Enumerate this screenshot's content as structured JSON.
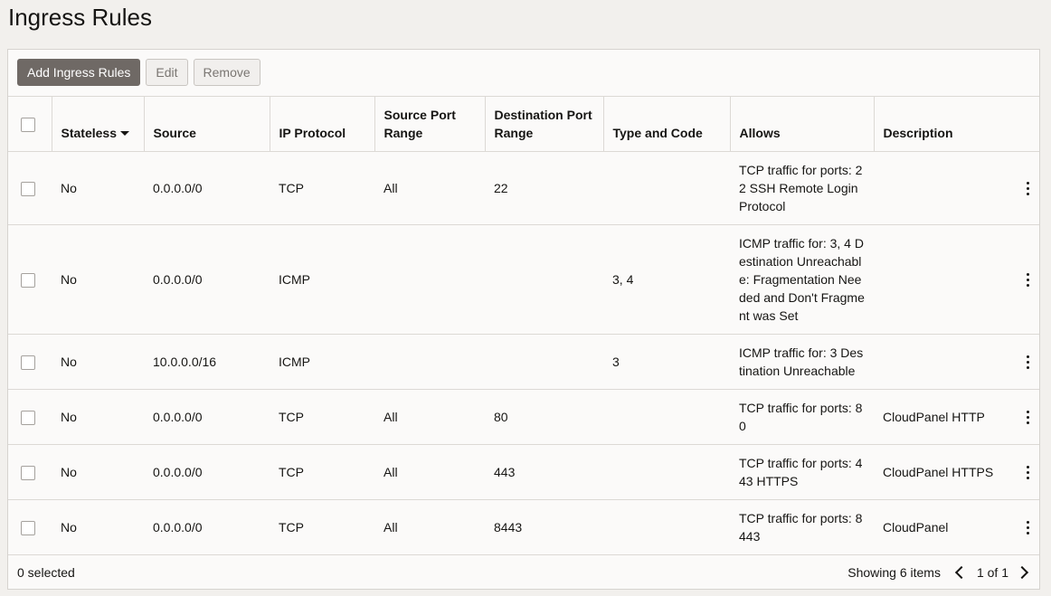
{
  "page": {
    "title": "Ingress Rules"
  },
  "toolbar": {
    "add_label": "Add Ingress Rules",
    "edit_label": "Edit",
    "remove_label": "Remove"
  },
  "table": {
    "headers": {
      "stateless": "Stateless",
      "source": "Source",
      "ip_protocol": "IP Protocol",
      "source_port_range": "Source Port Range",
      "destination_port_range": "Destination Port Range",
      "type_and_code": "Type and Code",
      "allows": "Allows",
      "description": "Description"
    },
    "rows": [
      {
        "stateless": "No",
        "source": "0.0.0.0/0",
        "ip_protocol": "TCP",
        "source_port_range": "All",
        "destination_port_range": "22",
        "type_and_code": "",
        "allows": "TCP traffic for ports: 22 SSH Remote Login Protocol",
        "description": ""
      },
      {
        "stateless": "No",
        "source": "0.0.0.0/0",
        "ip_protocol": "ICMP",
        "source_port_range": "",
        "destination_port_range": "",
        "type_and_code": "3, 4",
        "allows": "ICMP traffic for: 3, 4 Destination Unreachable: Fragmentation Needed and Don't Fragment was Set",
        "description": ""
      },
      {
        "stateless": "No",
        "source": "10.0.0.0/16",
        "ip_protocol": "ICMP",
        "source_port_range": "",
        "destination_port_range": "",
        "type_and_code": "3",
        "allows": "ICMP traffic for: 3 Destination Unreachable",
        "description": ""
      },
      {
        "stateless": "No",
        "source": "0.0.0.0/0",
        "ip_protocol": "TCP",
        "source_port_range": "All",
        "destination_port_range": "80",
        "type_and_code": "",
        "allows": "TCP traffic for ports: 80",
        "description": "CloudPanel HTTP"
      },
      {
        "stateless": "No",
        "source": "0.0.0.0/0",
        "ip_protocol": "TCP",
        "source_port_range": "All",
        "destination_port_range": "443",
        "type_and_code": "",
        "allows": "TCP traffic for ports: 443 HTTPS",
        "description": "CloudPanel HTTPS"
      },
      {
        "stateless": "No",
        "source": "0.0.0.0/0",
        "ip_protocol": "TCP",
        "source_port_range": "All",
        "destination_port_range": "8443",
        "type_and_code": "",
        "allows": "TCP traffic for ports: 8443",
        "description": "CloudPanel"
      }
    ]
  },
  "footer": {
    "selected": "0 selected",
    "showing": "Showing 6 items",
    "page": "1 of 1"
  },
  "icons": {
    "sort": "sort-descending-icon",
    "row_actions": "kebab-menu-icon",
    "prev": "chevron-left-icon",
    "next": "chevron-right-icon"
  }
}
